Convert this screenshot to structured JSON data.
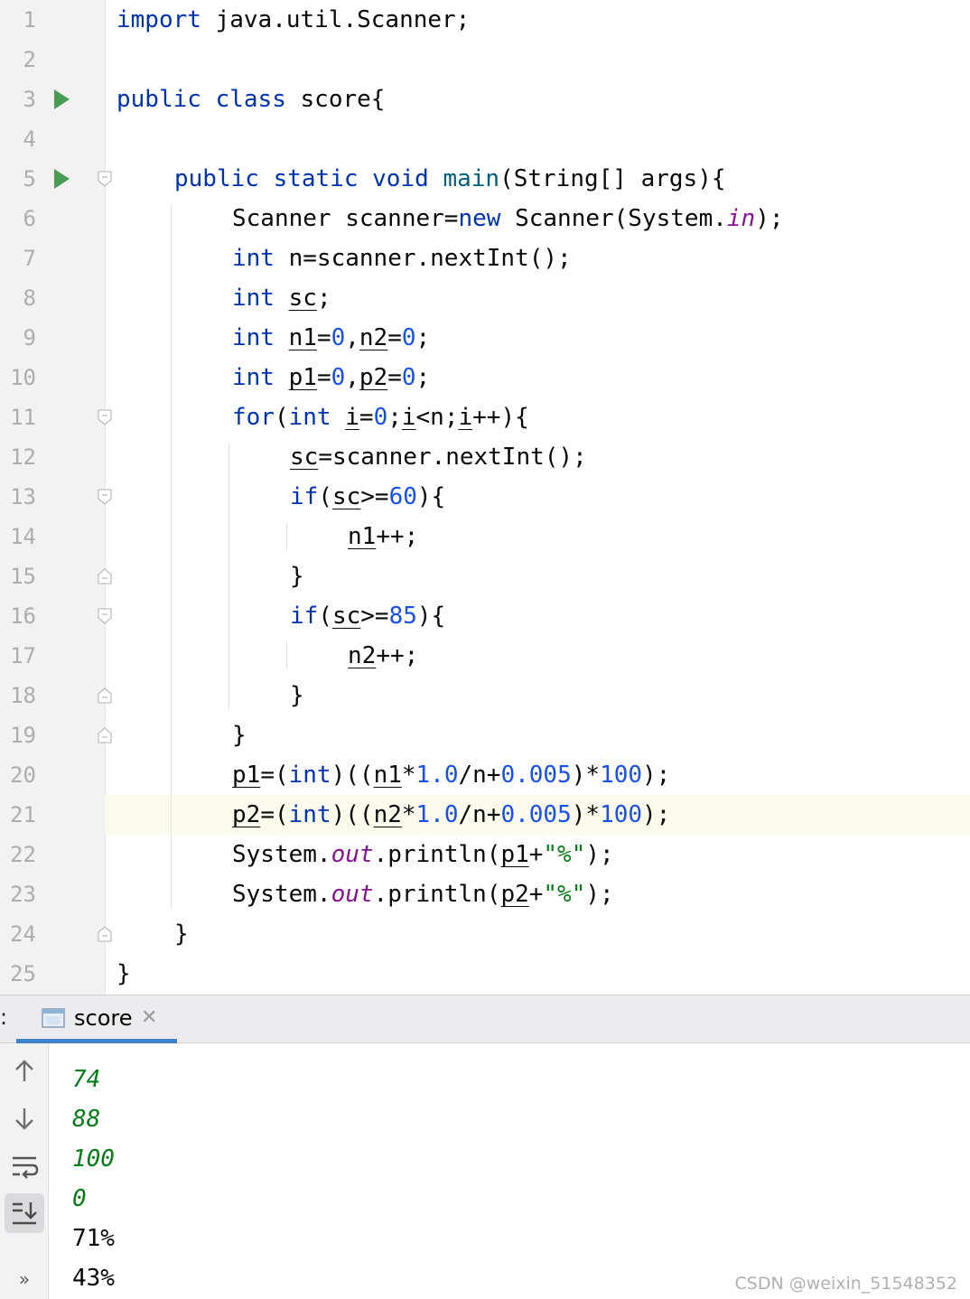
{
  "editor": {
    "current_line": 21,
    "lines": [
      {
        "n": "1",
        "indent": 0,
        "tokens": [
          {
            "t": "import",
            "c": "kw"
          },
          {
            "t": " java.util.Scanner;"
          }
        ]
      },
      {
        "n": "2",
        "indent": 0,
        "tokens": []
      },
      {
        "n": "3",
        "indent": 0,
        "run": true,
        "tokens": [
          {
            "t": "public",
            "c": "kw"
          },
          {
            "t": " "
          },
          {
            "t": "class",
            "c": "kw"
          },
          {
            "t": " score{"
          }
        ]
      },
      {
        "n": "4",
        "indent": 0,
        "tokens": []
      },
      {
        "n": "5",
        "indent": 4,
        "run": true,
        "fold": "open",
        "tokens": [
          {
            "t": "public",
            "c": "kw"
          },
          {
            "t": " "
          },
          {
            "t": "static",
            "c": "kw"
          },
          {
            "t": " "
          },
          {
            "t": "void",
            "c": "kw"
          },
          {
            "t": " "
          },
          {
            "t": "main",
            "c": "fn"
          },
          {
            "t": "(String[] args){"
          }
        ]
      },
      {
        "n": "6",
        "indent": 8,
        "tokens": [
          {
            "t": "Scanner scanner="
          },
          {
            "t": "new",
            "c": "kw"
          },
          {
            "t": " Scanner(System."
          },
          {
            "t": "in",
            "c": "sfield"
          },
          {
            "t": ");"
          }
        ]
      },
      {
        "n": "7",
        "indent": 8,
        "tokens": [
          {
            "t": "int",
            "c": "kw"
          },
          {
            "t": " n=scanner.nextInt();"
          }
        ]
      },
      {
        "n": "8",
        "indent": 8,
        "tokens": [
          {
            "t": "int",
            "c": "kw"
          },
          {
            "t": " "
          },
          {
            "t": "sc",
            "u": true
          },
          {
            "t": ";"
          }
        ]
      },
      {
        "n": "9",
        "indent": 8,
        "tokens": [
          {
            "t": "int",
            "c": "kw"
          },
          {
            "t": " "
          },
          {
            "t": "n1",
            "u": true
          },
          {
            "t": "="
          },
          {
            "t": "0",
            "c": "num"
          },
          {
            "t": ","
          },
          {
            "t": "n2",
            "u": true
          },
          {
            "t": "="
          },
          {
            "t": "0",
            "c": "num"
          },
          {
            "t": ";"
          }
        ]
      },
      {
        "n": "10",
        "indent": 8,
        "tokens": [
          {
            "t": "int",
            "c": "kw"
          },
          {
            "t": " "
          },
          {
            "t": "p1",
            "u": true
          },
          {
            "t": "="
          },
          {
            "t": "0",
            "c": "num"
          },
          {
            "t": ","
          },
          {
            "t": "p2",
            "u": true
          },
          {
            "t": "="
          },
          {
            "t": "0",
            "c": "num"
          },
          {
            "t": ";"
          }
        ]
      },
      {
        "n": "11",
        "indent": 8,
        "fold": "open",
        "tokens": [
          {
            "t": "for",
            "c": "kw"
          },
          {
            "t": "("
          },
          {
            "t": "int",
            "c": "kw"
          },
          {
            "t": " "
          },
          {
            "t": "i",
            "u": true
          },
          {
            "t": "="
          },
          {
            "t": "0",
            "c": "num"
          },
          {
            "t": ";"
          },
          {
            "t": "i",
            "u": true
          },
          {
            "t": "<n;"
          },
          {
            "t": "i",
            "u": true
          },
          {
            "t": "++){"
          }
        ]
      },
      {
        "n": "12",
        "indent": 12,
        "tokens": [
          {
            "t": "sc",
            "u": true
          },
          {
            "t": "=scanner.nextInt();"
          }
        ]
      },
      {
        "n": "13",
        "indent": 12,
        "fold": "open",
        "tokens": [
          {
            "t": "if",
            "c": "kw"
          },
          {
            "t": "("
          },
          {
            "t": "sc",
            "u": true
          },
          {
            "t": ">="
          },
          {
            "t": "60",
            "c": "num"
          },
          {
            "t": "){"
          }
        ]
      },
      {
        "n": "14",
        "indent": 16,
        "tokens": [
          {
            "t": "n1",
            "u": true
          },
          {
            "t": "++;"
          }
        ]
      },
      {
        "n": "15",
        "indent": 12,
        "fold": "close",
        "tokens": [
          {
            "t": "}"
          }
        ]
      },
      {
        "n": "16",
        "indent": 12,
        "fold": "open",
        "tokens": [
          {
            "t": "if",
            "c": "kw"
          },
          {
            "t": "("
          },
          {
            "t": "sc",
            "u": true
          },
          {
            "t": ">="
          },
          {
            "t": "85",
            "c": "num"
          },
          {
            "t": "){"
          }
        ]
      },
      {
        "n": "17",
        "indent": 16,
        "tokens": [
          {
            "t": "n2",
            "u": true
          },
          {
            "t": "++;"
          }
        ]
      },
      {
        "n": "18",
        "indent": 12,
        "fold": "close",
        "tokens": [
          {
            "t": "}"
          }
        ]
      },
      {
        "n": "19",
        "indent": 8,
        "fold": "close",
        "tokens": [
          {
            "t": "}"
          }
        ]
      },
      {
        "n": "20",
        "indent": 8,
        "tokens": [
          {
            "t": "p1",
            "u": true
          },
          {
            "t": "=("
          },
          {
            "t": "int",
            "c": "kw"
          },
          {
            "t": ")(("
          },
          {
            "t": "n1",
            "u": true
          },
          {
            "t": "*"
          },
          {
            "t": "1.0",
            "c": "num"
          },
          {
            "t": "/n+"
          },
          {
            "t": "0.005",
            "c": "num"
          },
          {
            "t": ")*"
          },
          {
            "t": "100",
            "c": "num"
          },
          {
            "t": ");"
          }
        ]
      },
      {
        "n": "21",
        "indent": 8,
        "tokens": [
          {
            "t": "p2",
            "u": true
          },
          {
            "t": "=("
          },
          {
            "t": "int",
            "c": "kw"
          },
          {
            "t": ")(("
          },
          {
            "t": "n2",
            "u": true
          },
          {
            "t": "*"
          },
          {
            "t": "1.0",
            "c": "num"
          },
          {
            "t": "/n+"
          },
          {
            "t": "0.005",
            "c": "num"
          },
          {
            "t": ")*"
          },
          {
            "t": "100",
            "c": "num"
          },
          {
            "t": ");"
          }
        ]
      },
      {
        "n": "22",
        "indent": 8,
        "tokens": [
          {
            "t": "System."
          },
          {
            "t": "out",
            "c": "sfield"
          },
          {
            "t": ".println("
          },
          {
            "t": "p1",
            "u": true
          },
          {
            "t": "+"
          },
          {
            "t": "\"%\"",
            "c": "str"
          },
          {
            "t": ");"
          }
        ]
      },
      {
        "n": "23",
        "indent": 8,
        "tokens": [
          {
            "t": "System."
          },
          {
            "t": "out",
            "c": "sfield"
          },
          {
            "t": ".println("
          },
          {
            "t": "p2",
            "u": true
          },
          {
            "t": "+"
          },
          {
            "t": "\"%\"",
            "c": "str"
          },
          {
            "t": ");"
          }
        ]
      },
      {
        "n": "24",
        "indent": 4,
        "fold": "close",
        "tokens": [
          {
            "t": "}"
          }
        ]
      },
      {
        "n": "25",
        "indent": 0,
        "tokens": [
          {
            "t": "}"
          }
        ]
      }
    ]
  },
  "run_panel": {
    "tab_prefix": ":",
    "tab_label": "score",
    "close_glyph": "✕",
    "toolbar_icons": [
      "arrow-up-icon",
      "arrow-down-icon",
      "soft-wrap-icon",
      "scroll-to-end-icon",
      "more-icon"
    ],
    "more_glyph": "»",
    "console_lines": [
      {
        "text": "74",
        "kind": "input"
      },
      {
        "text": "88",
        "kind": "input"
      },
      {
        "text": "100",
        "kind": "input"
      },
      {
        "text": "0",
        "kind": "input"
      },
      {
        "text": "71%",
        "kind": "stdout"
      },
      {
        "text": "43%",
        "kind": "stdout"
      }
    ]
  },
  "watermark": "CSDN @weixin_51548352",
  "colors": {
    "keyword": "#0033b3",
    "number": "#1750eb",
    "string": "#067d17",
    "static_field": "#871094",
    "run_icon": "#499c54",
    "tab_underline": "#4083c9",
    "current_line": "#fcfaed"
  }
}
